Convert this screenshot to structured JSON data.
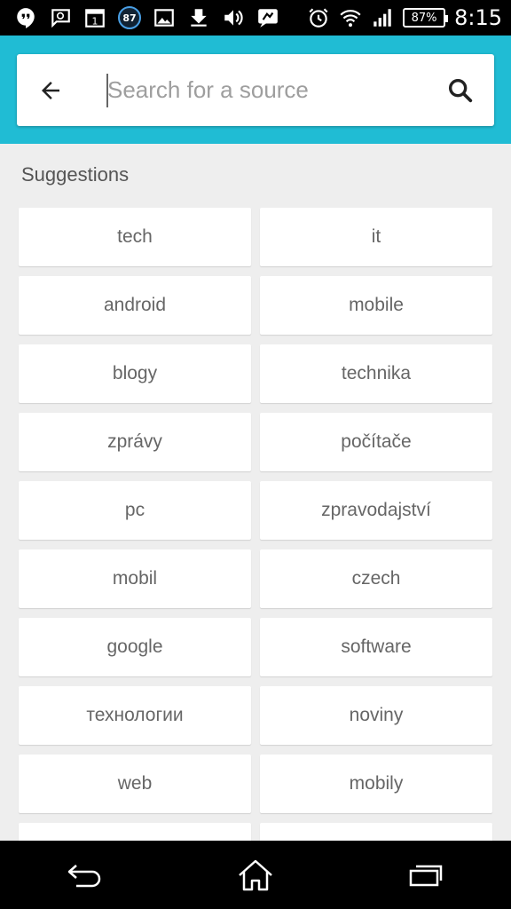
{
  "status_bar": {
    "notification_count": "87",
    "battery_percent": "87%",
    "time": "8:15",
    "icons": [
      "hangouts-icon",
      "chat-icon",
      "calendar-icon",
      "badge-icon",
      "image-icon",
      "download-icon",
      "volume-icon",
      "feedback-icon",
      "alarm-icon",
      "wifi-icon",
      "signal-icon",
      "battery-icon"
    ],
    "calendar_day": "1"
  },
  "header": {
    "accent_color": "#20bcd4",
    "search": {
      "placeholder": "Search for a source",
      "value": ""
    }
  },
  "suggestions": {
    "title": "Suggestions",
    "items": [
      "tech",
      "it",
      "android",
      "mobile",
      "blogy",
      "technika",
      "zprávy",
      "počítače",
      "pc",
      "zpravodajství",
      "mobil",
      "czech",
      "google",
      "software",
      "технологии",
      "noviny",
      "web",
      "mobily",
      "",
      ""
    ]
  },
  "nav_bar": {
    "icons": [
      "back-icon",
      "home-icon",
      "recent-apps-icon"
    ]
  }
}
